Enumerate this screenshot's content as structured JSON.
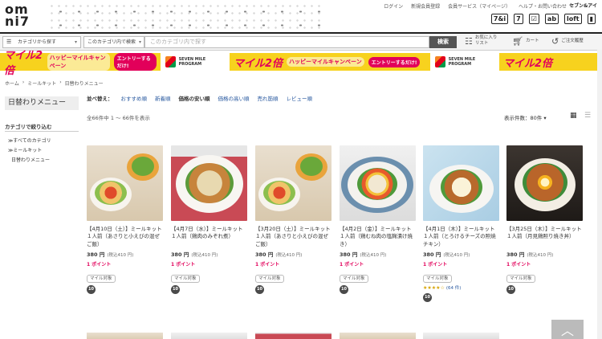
{
  "header": {
    "logo": "omni7",
    "links": [
      "ログイン",
      "新規会員登録",
      "会員サービス（マイページ）",
      "ヘルプ・お問い合わせ"
    ],
    "corp": "セブン&アイ",
    "brands": [
      "7&i",
      "7",
      "☑",
      "ab",
      "loft",
      "▮"
    ]
  },
  "search": {
    "category_label": "カテゴリから探す",
    "scope_label": "このカテゴリ内で検索",
    "placeholder": "このカテゴリ内で探す",
    "button": "検索",
    "favorites": "お気に入りリスト",
    "cart": "カート",
    "history": "ご注文履歴"
  },
  "banner": {
    "big": "マイル2倍",
    "campaign": "ハッピーマイルキャンペーン",
    "entry": "エントリーするだけ!",
    "program": "SEVEN MILE PROGRAM"
  },
  "breadcrumb": [
    "ホーム",
    "ミールキット",
    "日替わりメニュー"
  ],
  "sidebar": {
    "title": "日替わりメニュー",
    "filter": "カテゴリで絞り込む",
    "links": [
      "≫すべてのカテゴリ",
      "≫ミールキット",
      "日替わりメニュー"
    ]
  },
  "sort": {
    "label": "並べ替え：",
    "options": [
      "おすすめ順",
      "新着順",
      "価格の安い順",
      "価格の高い順",
      "売れ筋順",
      "レビュー順"
    ],
    "active": "価格の安い順"
  },
  "results": {
    "count_text": "全66件中 1 ～ 66件を表示",
    "per_page": "表示件数：80件 ▾"
  },
  "products": [
    {
      "name": "【4月10日（土）】ミールキット１人前（あさりと小えびの混ぜご飯）",
      "price": "380 円",
      "tax": "(税込410 円)",
      "point": "1 ポイント",
      "tag": "マイル対象",
      "badge": "10"
    },
    {
      "name": "【4月7日（水）】ミールキット１人前（鶏肉のみぞれ煮）",
      "price": "380 円",
      "tax": "(税込410 円)",
      "point": "1 ポイント",
      "tag": "マイル対象",
      "badge": "10"
    },
    {
      "name": "【3月20日（土）】ミールキット１人前（あさりと小えびの混ぜご飯）",
      "price": "380 円",
      "tax": "(税込410 円)",
      "point": "1 ポイント",
      "tag": "マイル対象",
      "badge": "10"
    },
    {
      "name": "【4月2日（金）】ミールキット１人前（鶏むね肉の塩麹漬け焼き）",
      "price": "380 円",
      "tax": "(税込410 円)",
      "point": "1 ポイント",
      "tag": "マイル対象",
      "badge": "10"
    },
    {
      "name": "【4月1日（木）】ミールキット１人前（とろけるチーズの照焼チキン）",
      "price": "380 円",
      "tax": "(税込410 円)",
      "point": "1 ポイント",
      "tag": "マイル対象",
      "rating": "★★★★☆",
      "reviews": "(64 件)",
      "badge": "10"
    },
    {
      "name": "【3月25日（木）】ミールキット１人前（月見鶏照り焼き丼）",
      "price": "380 円",
      "tax": "(税込410 円)",
      "point": "1 ポイント",
      "tag": "マイル対象",
      "badge": "10"
    }
  ],
  "totop": "︿"
}
